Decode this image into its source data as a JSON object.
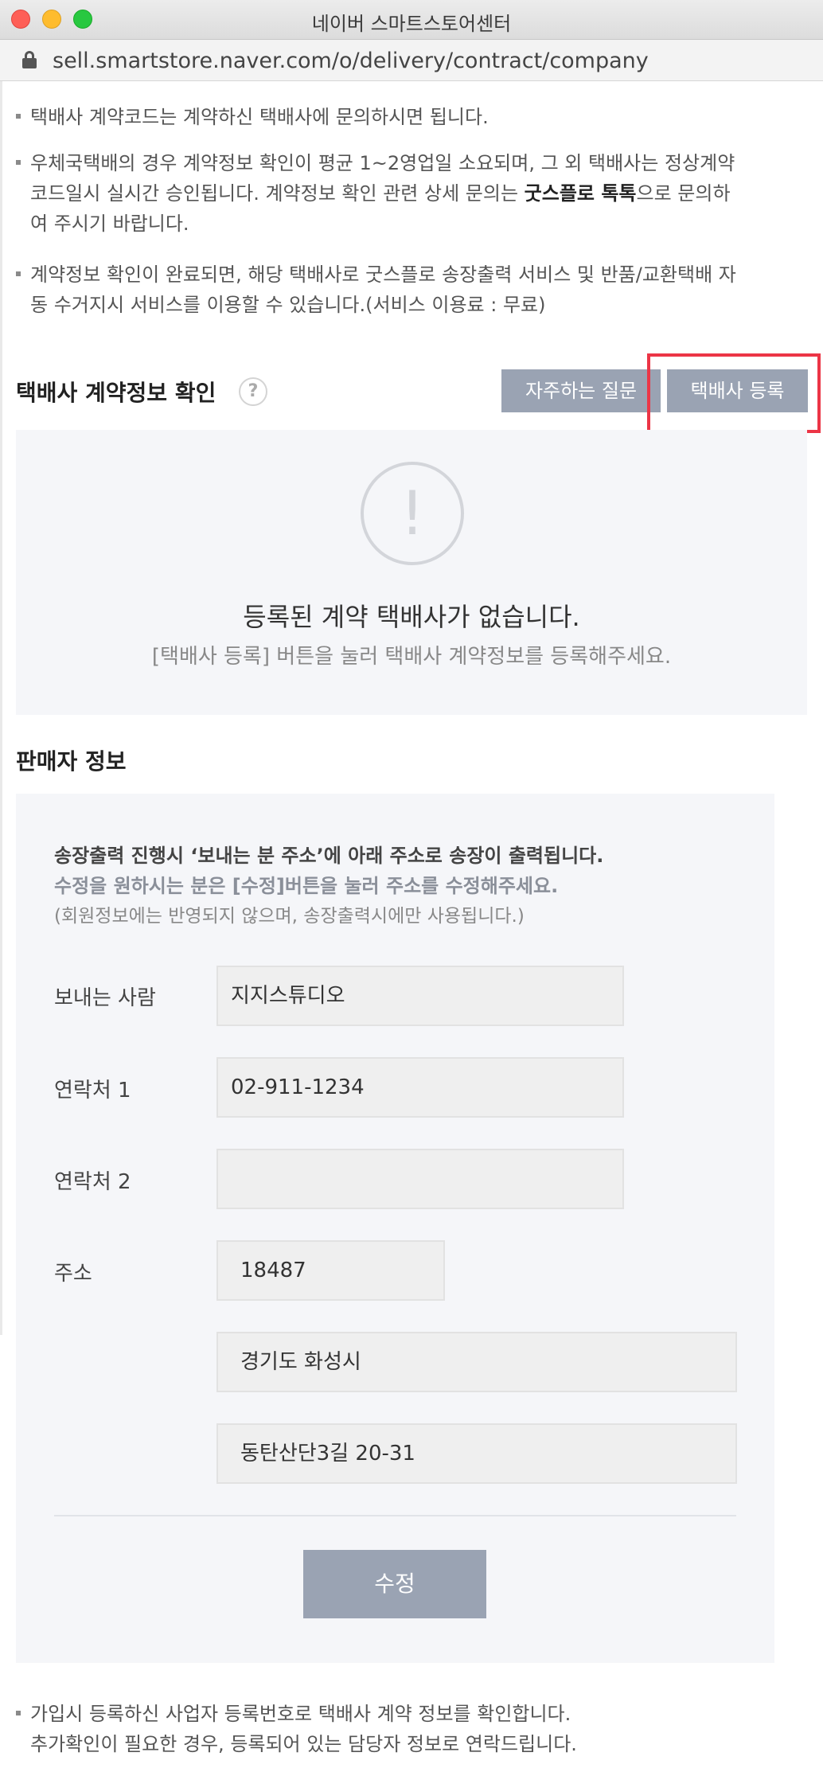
{
  "window": {
    "title": "네이버 스마트스토어센터",
    "url": "sell.smartstore.naver.com/o/delivery/contract/company"
  },
  "notes": [
    [
      "택배사 계약코드는 계약하신 택배사에 문의하시면 됩니다."
    ],
    [
      "우체국택배의 경우 계약정보 확인이 평균 1~2영업일 소요되며, 그 외 택배사는 정상계약",
      "코드일시 실시간 승인됩니다. 계약정보 확인 관련 상세 문의는 ",
      "굿스플로 톡톡",
      "으로 문의하",
      "여 주시기 바랍니다."
    ],
    [
      "계약정보 확인이 완료되면, 해당 택배사로 굿스플로 송장출력 서비스 및 반품/교환택배 자",
      "동 수거지시 서비스를 이용할 수 있습니다.(서비스 이용료 : 무료)"
    ]
  ],
  "contract_section": {
    "title": "택배사 계약정보 확인",
    "help_icon": "?",
    "faq_button": "자주하는 질문",
    "register_button": "택배사 등록",
    "empty_icon": "!",
    "empty_message": "등록된 계약 택배사가 없습니다.",
    "empty_sub": "[택배사 등록] 버튼을 눌러 택배사 계약정보를 등록해주세요."
  },
  "seller_section": {
    "title": "판매자 정보",
    "info_line1": "송장출력 진행시 ‘보내는 분 주소’에 아래 주소로 송장이 출력됩니다.",
    "info_line2": "수정을 원하시는 분은 [수정]버튼을 눌러 주소를 수정해주세요.",
    "info_line3": "(회원정보에는 반영되지 않으며, 송장출력시에만 사용됩니다.)",
    "sender_label": "보내는 사람",
    "sender_value": "지지스튜디오",
    "phone1_label": "연락처 1",
    "phone1_value": "02-911-1234",
    "phone2_label": "연락처 2",
    "phone2_value": "",
    "address_label": "주소",
    "zipcode": "18487",
    "address1": "경기도 화성시",
    "address2": "동탄산단3길 20-31",
    "edit_button": "수정"
  },
  "footer_note": {
    "line1": "가입시 등록하신 사업자 등록번호로 택배사 계약 정보를 확인합니다.",
    "line2": "추가확인이 필요한 경우, 등록되어 있는 담당자 정보로 연락드립니다."
  }
}
